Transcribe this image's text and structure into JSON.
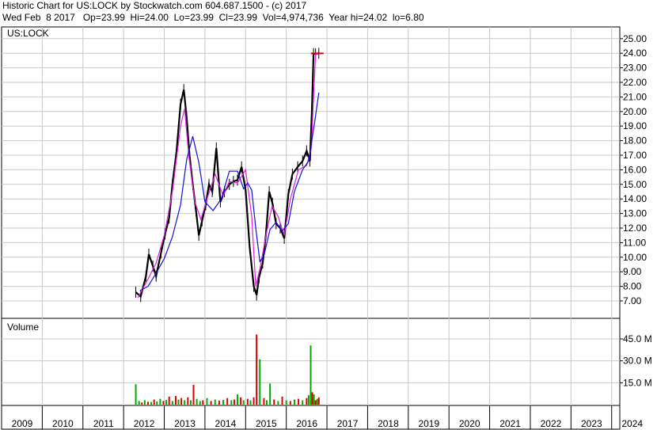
{
  "header": {
    "line1": "Historic Chart for US:LOCK by Stockwatch.com 604.687.1500 - (c) 2017",
    "line2": "Wed Feb  8 2017   Op=23.99  Hi=24.00  Lo=23.99  Cl=23.99  Vol=4,974,736  Year hi=24.02  lo=6.80"
  },
  "colors": {
    "price": "#000000",
    "ma_short": "#e020e0",
    "ma_long": "#1010e0",
    "vol_up": "#00aa00",
    "vol_down": "#dd0000",
    "grid": "#c8c8c8"
  },
  "chart_data": [
    {
      "type": "line",
      "title": "US:LOCK",
      "x_tick_labels": [
        "2009",
        "2010",
        "2011",
        "2012",
        "2013",
        "2014",
        "2015",
        "2016",
        "2017",
        "2018",
        "2019",
        "2020",
        "2021",
        "2022",
        "2023",
        "2024"
      ],
      "y_tick_labels": [
        "7.00",
        "8.00",
        "9.00",
        "10.00",
        "11.00",
        "12.00",
        "13.00",
        "14.00",
        "15.00",
        "16.00",
        "17.00",
        "18.00",
        "19.00",
        "20.00",
        "21.00",
        "22.00",
        "23.00",
        "24.00",
        "25.00"
      ],
      "ylim": [
        6.0,
        25.7
      ],
      "xlim": [
        2009.0,
        2024.2
      ],
      "grid": true,
      "series": [
        {
          "style": "price-bars",
          "x": [
            2012.3,
            2012.42,
            2012.55,
            2012.62,
            2012.72,
            2012.8,
            2012.92,
            2013.02,
            2013.12,
            2013.2,
            2013.3,
            2013.4,
            2013.48,
            2013.55,
            2013.62,
            2013.7,
            2013.78,
            2013.85,
            2013.93,
            2014.02,
            2014.1,
            2014.18,
            2014.28,
            2014.38,
            2014.48,
            2014.6,
            2014.7,
            2014.8,
            2014.9,
            2015.0,
            2015.1,
            2015.2,
            2015.27,
            2015.33,
            2015.42,
            2015.5,
            2015.58,
            2015.66,
            2015.75,
            2015.85,
            2015.95,
            2016.05,
            2016.15,
            2016.28,
            2016.4,
            2016.5,
            2016.58,
            2016.63,
            2016.67,
            2016.72,
            2016.8
          ],
          "y": [
            7.6,
            7.3,
            8.7,
            10.2,
            9.4,
            8.7,
            10.3,
            11.6,
            12.7,
            15.0,
            17.2,
            20.5,
            21.5,
            19.6,
            17.0,
            15.0,
            13.2,
            11.5,
            12.5,
            13.6,
            15.0,
            14.5,
            17.5,
            13.8,
            14.5,
            15.0,
            15.2,
            15.3,
            16.2,
            14.6,
            10.7,
            8.0,
            7.4,
            8.6,
            9.6,
            11.6,
            14.5,
            13.7,
            12.3,
            12.0,
            11.3,
            14.3,
            15.7,
            16.2,
            16.6,
            17.3,
            16.6,
            20.0,
            23.98,
            23.96,
            23.99
          ]
        },
        {
          "name": "",
          "style": "ma-short",
          "x": [
            2012.35,
            2012.6,
            2012.8,
            2013.0,
            2013.2,
            2013.4,
            2013.5,
            2013.6,
            2013.75,
            2013.9,
            2014.05,
            2014.25,
            2014.45,
            2014.6,
            2014.8,
            2015.0,
            2015.15,
            2015.25,
            2015.35,
            2015.5,
            2015.65,
            2015.8,
            2015.95,
            2016.1,
            2016.3,
            2016.5,
            2016.62,
            2016.67,
            2016.72,
            2016.8
          ],
          "y": [
            7.2,
            8.5,
            9.6,
            11.5,
            14.5,
            19.0,
            20.2,
            17.0,
            13.8,
            12.6,
            14.0,
            15.7,
            14.2,
            15.2,
            15.1,
            16.0,
            12.8,
            8.0,
            9.2,
            11.5,
            13.5,
            12.8,
            11.5,
            14.0,
            16.0,
            16.3,
            17.5,
            21.0,
            23.9,
            24.0
          ]
        },
        {
          "name": "",
          "style": "ma-long",
          "x": [
            2012.4,
            2012.6,
            2012.8,
            2013.0,
            2013.2,
            2013.4,
            2013.55,
            2013.7,
            2013.85,
            2014.0,
            2014.2,
            2014.4,
            2014.6,
            2014.8,
            2014.95,
            2015.05,
            2015.15,
            2015.25,
            2015.35,
            2015.45,
            2015.6,
            2015.75,
            2015.9,
            2016.05,
            2016.2,
            2016.4,
            2016.55,
            2016.7,
            2016.8
          ],
          "y": [
            7.7,
            8.0,
            8.9,
            9.9,
            11.4,
            13.6,
            16.7,
            18.3,
            16.5,
            13.8,
            13.2,
            14.0,
            15.9,
            15.9,
            14.7,
            15.1,
            14.6,
            12.0,
            9.7,
            10.1,
            11.9,
            12.4,
            11.8,
            12.3,
            14.5,
            16.0,
            16.6,
            19.3,
            21.3
          ]
        }
      ]
    },
    {
      "type": "bar",
      "title": "Volume",
      "x_tick_labels": [
        "2009",
        "2010",
        "2011",
        "2012",
        "2013",
        "2014",
        "2015",
        "2016",
        "2017",
        "2018",
        "2019",
        "2020",
        "2021",
        "2022",
        "2023",
        "2024"
      ],
      "y_tick_labels": [
        "15.0 M",
        "30.0 M",
        "45.0 M"
      ],
      "ylim": [
        0,
        58
      ],
      "grid": true,
      "bars": {
        "x": [
          2012.3,
          2012.38,
          2012.45,
          2012.52,
          2012.6,
          2012.68,
          2012.75,
          2012.82,
          2012.9,
          2012.98,
          2013.05,
          2013.12,
          2013.2,
          2013.28,
          2013.35,
          2013.42,
          2013.5,
          2013.58,
          2013.65,
          2013.72,
          2013.8,
          2013.88,
          2013.95,
          2014.05,
          2014.15,
          2014.25,
          2014.35,
          2014.45,
          2014.55,
          2014.65,
          2014.72,
          2014.8,
          2014.88,
          2014.95,
          2015.05,
          2015.12,
          2015.2,
          2015.27,
          2015.35,
          2015.45,
          2015.52,
          2015.6,
          2015.7,
          2015.8,
          2015.9,
          2016.0,
          2016.1,
          2016.2,
          2016.3,
          2016.4,
          2016.5,
          2016.55,
          2016.6,
          2016.64,
          2016.68,
          2016.72,
          2016.76,
          2016.8
        ],
        "v": [
          14.0,
          2.5,
          1.5,
          3.0,
          2.0,
          1.8,
          3.5,
          2.2,
          4.0,
          2.5,
          3.2,
          5.5,
          2.5,
          6.0,
          3.5,
          4.5,
          3.0,
          5.0,
          3.0,
          13.5,
          4.0,
          2.5,
          3.0,
          4.5,
          2.5,
          3.5,
          2.8,
          3.2,
          4.5,
          3.0,
          3.5,
          7.0,
          5.0,
          3.0,
          4.0,
          3.0,
          5.0,
          48.0,
          31.0,
          4.5,
          3.0,
          14.5,
          3.5,
          2.5,
          5.5,
          3.0,
          2.5,
          3.5,
          4.0,
          3.0,
          4.5,
          6.5,
          40.5,
          8.5,
          7.0,
          3.0,
          4.0,
          5.0
        ],
        "up": [
          true,
          true,
          false,
          true,
          false,
          true,
          false,
          true,
          true,
          false,
          true,
          false,
          true,
          false,
          true,
          false,
          true,
          false,
          true,
          false,
          true,
          true,
          false,
          true,
          false,
          true,
          false,
          true,
          false,
          true,
          false,
          true,
          false,
          true,
          false,
          true,
          false,
          false,
          true,
          false,
          true,
          true,
          false,
          true,
          false,
          true,
          false,
          true,
          false,
          true,
          false,
          true,
          true,
          false,
          true,
          false,
          true,
          false
        ]
      }
    }
  ]
}
